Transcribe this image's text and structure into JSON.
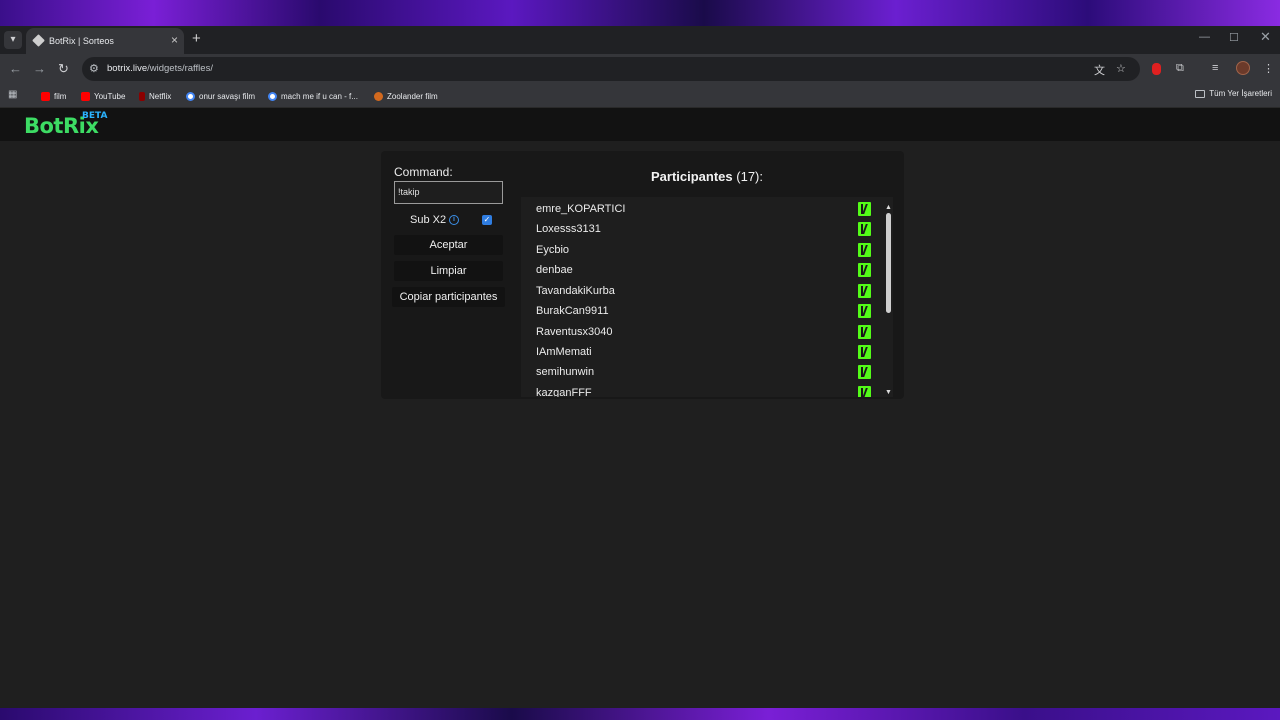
{
  "browser": {
    "tab_title": "BotRix | Sorteos",
    "url_host": "botrix.live",
    "url_path": "/widgets/raffles/",
    "bookmarks": [
      {
        "label": "film",
        "icon": "youtube-icon"
      },
      {
        "label": "YouTube",
        "icon": "youtube-icon"
      },
      {
        "label": "Netflix",
        "icon": "netflix-icon"
      },
      {
        "label": "onur savaşı film",
        "icon": "google-icon"
      },
      {
        "label": "mach me if u can - f...",
        "icon": "google-icon"
      },
      {
        "label": "Zoolander film",
        "icon": "zoolander-icon"
      }
    ],
    "all_bookmarks_label": "Tüm Yer İşaretleri"
  },
  "app": {
    "logo": "BotRix",
    "badge": "BETA"
  },
  "controls": {
    "command_label": "Command:",
    "command_value": "!takip",
    "sub_label": "Sub X2",
    "sub_checked": true,
    "accept_label": "Aceptar",
    "clear_label": "Limpiar",
    "copy_label": "Copiar participantes"
  },
  "participants": {
    "title": "Participantes",
    "count": "(17):",
    "names": [
      "emre_KOPARTICI",
      "Loxesss3131",
      "Eycbio",
      "denbae",
      "TavandakiKurba",
      "BurakCan9911",
      "Raventusx3040",
      "IAmMemati",
      "semihunwin",
      "kazganFFF"
    ]
  },
  "colors": {
    "logo": "#3ddc64",
    "beta": "#2ab3ff",
    "kick": "#53fc18",
    "checkbox": "#2f7de1"
  }
}
